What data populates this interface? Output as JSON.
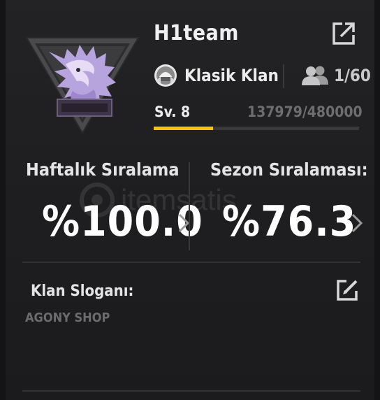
{
  "clan": {
    "name": "H1team",
    "type_label": "Klasik Klan",
    "members": "1/60",
    "level_label": "Sv. 8",
    "exp": "137979/480000",
    "exp_progress": 0.2875
  },
  "rankings": {
    "weekly": {
      "title": "Haftalık Sıralama",
      "value": "%100.0"
    },
    "season": {
      "title": "Sezon Sıralaması:",
      "value": "%76.3"
    }
  },
  "slogan": {
    "label": "Klan Sloganı:",
    "text": "AGONY SHOP"
  },
  "watermark": {
    "text": "itemsatis"
  },
  "colors": {
    "accent_exp": "#f4c214",
    "emblem_purple": "#b39ddb",
    "background": "#1d1d1f"
  }
}
